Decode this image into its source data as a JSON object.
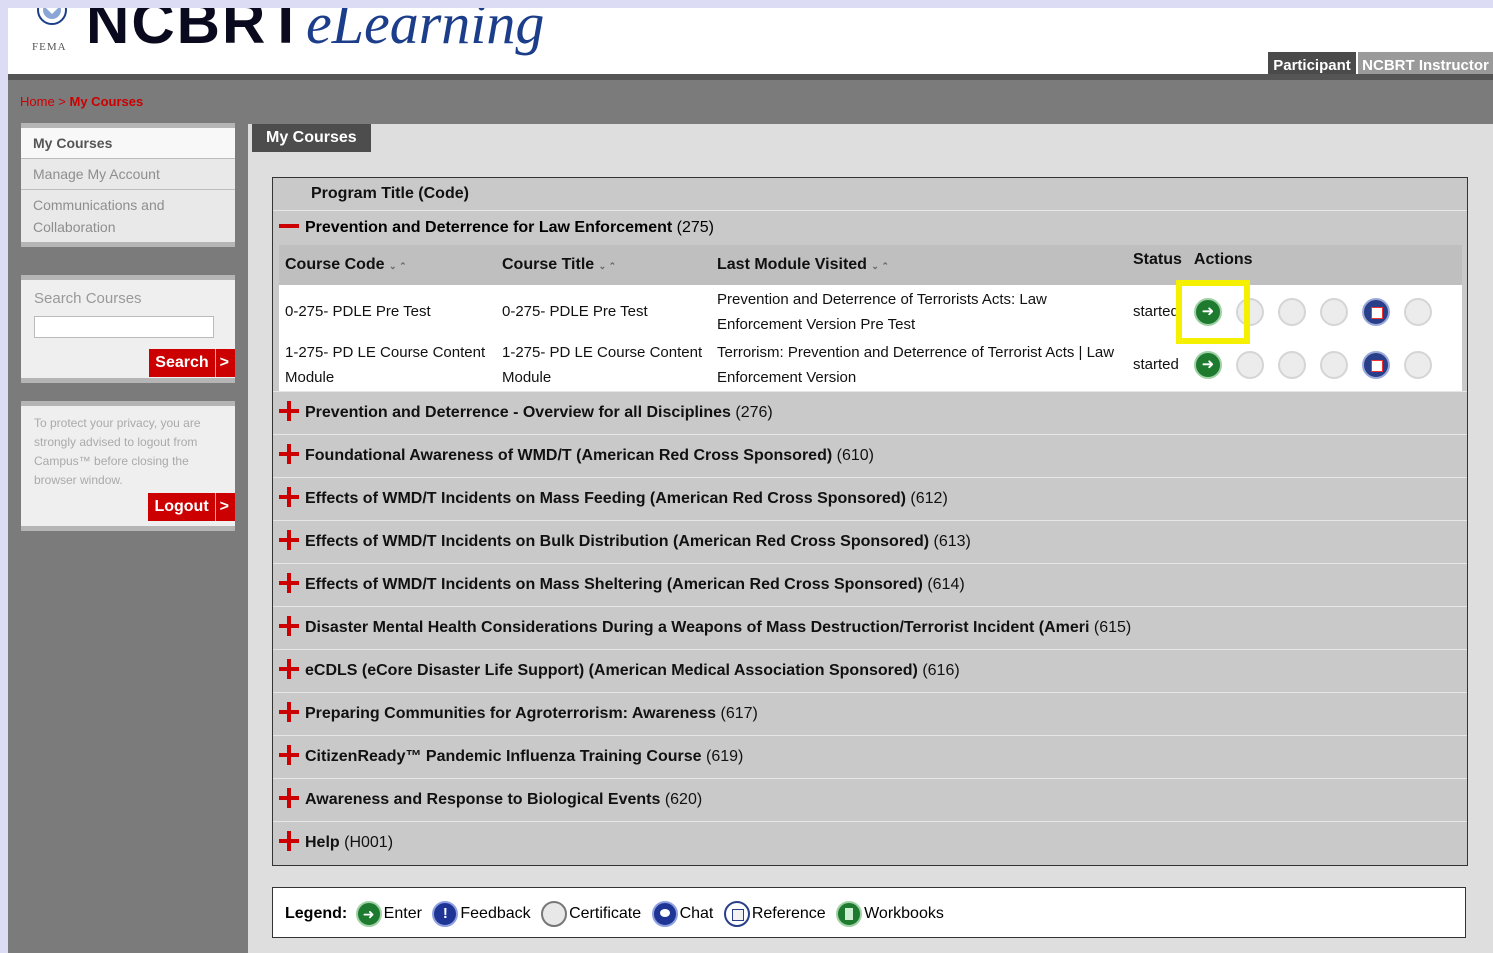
{
  "header": {
    "brand_bold": "NCBRT",
    "brand_italic": "eLearning",
    "agency": "FEMA",
    "tabs": [
      "Participant",
      "NCBRT Instructor"
    ]
  },
  "breadcrumb": {
    "home": "Home",
    "sep": " > ",
    "current": "My Courses"
  },
  "sidebar": {
    "items": [
      {
        "label": "My Courses",
        "active": true
      },
      {
        "label": "Manage My Account"
      },
      {
        "label": "Communications and Collaboration"
      }
    ],
    "search": {
      "label": "Search Courses",
      "value": "",
      "button": "Search",
      "arrow": ">"
    },
    "privacy": {
      "text": "To protect your privacy, you are strongly advised to logout from Campus™ before closing the browser window.",
      "button": "Logout",
      "arrow": ">"
    }
  },
  "main": {
    "tab": "My Courses",
    "program_header": "Program Title (Code)",
    "expanded_program": {
      "title": "Prevention and Deterrence for Law Enforcement",
      "code": "(275)"
    },
    "columns": {
      "code": "Course Code",
      "title": "Course Title",
      "last": "Last Module Visited",
      "status": "Status",
      "actions": "Actions"
    },
    "courses": [
      {
        "code": "0-275- PDLE Pre Test",
        "title": "0-275- PDLE Pre Test",
        "last": "Prevention and Deterrence of Terrorists Acts: Law Enforcement Version Pre Test",
        "status": "started"
      },
      {
        "code": "1-275- PD LE Course Content Module",
        "title": "1-275- PD LE Course Content Module",
        "last": "Terrorism: Prevention and Deterrence of Terrorist Acts | Law Enforcement Version",
        "status": "started"
      }
    ],
    "programs": [
      {
        "title": "Prevention and Deterrence - Overview for all Disciplines",
        "code": "(276)"
      },
      {
        "title": "Foundational Awareness of WMD/T (American Red Cross Sponsored)",
        "code": "(610)"
      },
      {
        "title": "Effects of WMD/T Incidents on Mass Feeding (American Red Cross Sponsored)",
        "code": "(612)"
      },
      {
        "title": "Effects of WMD/T Incidents on Bulk Distribution (American Red Cross Sponsored)",
        "code": "(613)"
      },
      {
        "title": "Effects of WMD/T Incidents on Mass Sheltering (American Red Cross Sponsored)",
        "code": "(614)"
      },
      {
        "title": "Disaster Mental Health Considerations During a Weapons of Mass Destruction/Terrorist Incident (Ameri",
        "code": "(615)"
      },
      {
        "title": "eCDLS (eCore Disaster Life Support) (American Medical Association Sponsored)",
        "code": "(616)"
      },
      {
        "title": "Preparing Communities for Agroterrorism: Awareness",
        "code": "(617)"
      },
      {
        "title": "CitizenReady™ Pandemic Influenza Training Course",
        "code": "(619)"
      },
      {
        "title": "Awareness and Response to Biological Events",
        "code": "(620)"
      },
      {
        "title": "Help",
        "code": "(H001)"
      }
    ],
    "legend": {
      "label": "Legend:",
      "items": [
        "Enter",
        "Feedback",
        "Certificate",
        "Chat",
        "Reference",
        "Workbooks"
      ]
    }
  },
  "colors": {
    "accent_red": "#cc0000",
    "highlight": "#f4f000",
    "enter_green": "#1d7a2f"
  }
}
